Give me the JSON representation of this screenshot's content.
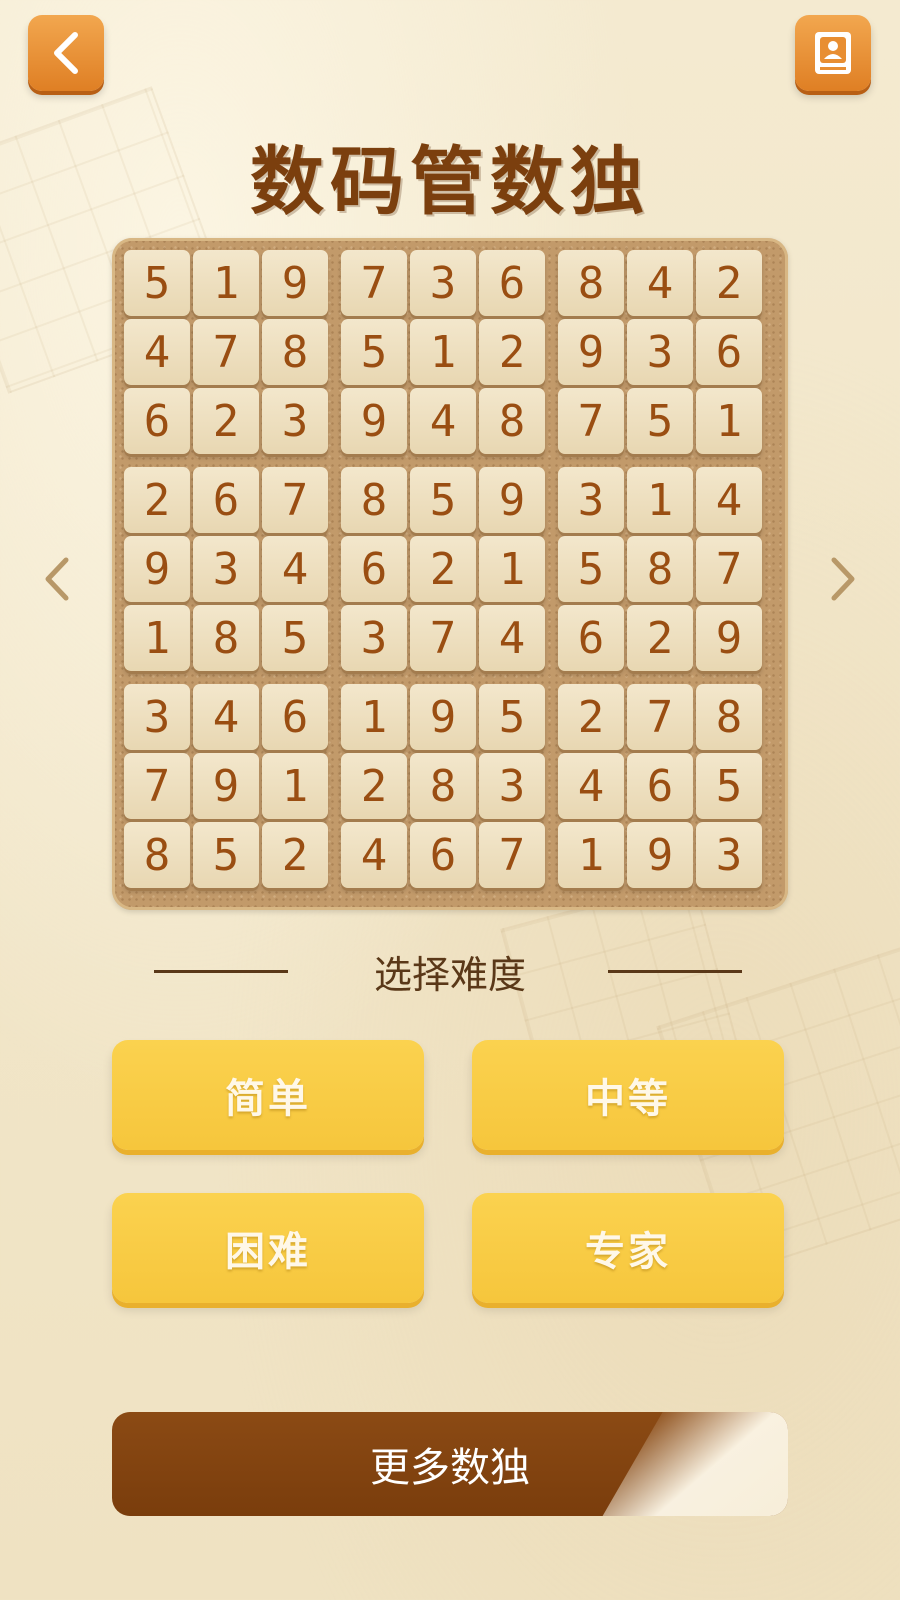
{
  "header": {
    "back_icon": "chevron-left-icon",
    "book_icon": "book-icon",
    "title": "数码管数独"
  },
  "board": {
    "rows": [
      [
        "5",
        "1",
        "9",
        "7",
        "3",
        "6",
        "8",
        "4",
        "2"
      ],
      [
        "4",
        "7",
        "8",
        "5",
        "1",
        "2",
        "9",
        "3",
        "6"
      ],
      [
        "6",
        "2",
        "3",
        "9",
        "4",
        "8",
        "7",
        "5",
        "1"
      ],
      [
        "2",
        "6",
        "7",
        "8",
        "5",
        "9",
        "3",
        "1",
        "4"
      ],
      [
        "9",
        "3",
        "4",
        "6",
        "2",
        "1",
        "5",
        "8",
        "7"
      ],
      [
        "1",
        "8",
        "5",
        "3",
        "7",
        "4",
        "6",
        "2",
        "9"
      ],
      [
        "3",
        "4",
        "6",
        "1",
        "9",
        "5",
        "2",
        "7",
        "8"
      ],
      [
        "7",
        "9",
        "1",
        "2",
        "8",
        "3",
        "4",
        "6",
        "5"
      ],
      [
        "8",
        "5",
        "2",
        "4",
        "6",
        "7",
        "1",
        "9",
        "3"
      ]
    ]
  },
  "navigation": {
    "prev_icon": "chevron-left-icon",
    "next_icon": "chevron-right-icon"
  },
  "difficulty": {
    "label": "选择难度",
    "easy": "简单",
    "medium": "中等",
    "hard": "困难",
    "expert": "专家"
  },
  "more_button": {
    "label": "更多数独"
  },
  "colors": {
    "accent_orange": "#e88e32",
    "title_brown": "#7b3f0e",
    "button_yellow": "#f8cb44",
    "button_dark_brown": "#7f410f"
  }
}
